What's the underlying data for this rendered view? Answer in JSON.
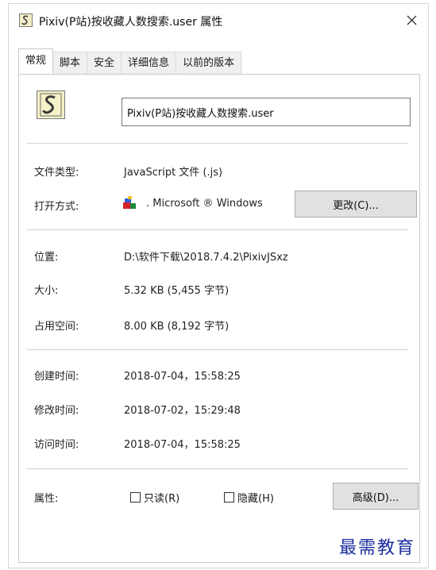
{
  "window": {
    "title": "Pixiv(P站)按收藏人数搜索.user 属性",
    "close_symbol": "✕"
  },
  "tabs": [
    {
      "label": "常规",
      "active": true
    },
    {
      "label": "脚本",
      "active": false
    },
    {
      "label": "安全",
      "active": false
    },
    {
      "label": "详细信息",
      "active": false
    },
    {
      "label": "以前的版本",
      "active": false
    }
  ],
  "file": {
    "icon": "script-file-icon",
    "name": "Pixiv(P站)按收藏人数搜索.user"
  },
  "type": {
    "label": "文件类型:",
    "value": "JavaScript 文件 (.js)"
  },
  "open_with": {
    "label": "打开方式:",
    "app_icon": "windows-script-host-icon",
    "value": ". Microsoft ® Windows",
    "change_button": "更改(C)..."
  },
  "location": {
    "label": "位置:",
    "value": "D:\\软件下载\\2018.7.4.2\\PixivJSxz"
  },
  "size": {
    "label": "大小:",
    "value": "5.32 KB (5,455 字节)"
  },
  "size_on_disk": {
    "label": "占用空间:",
    "value": "8.00 KB (8,192 字节)"
  },
  "created": {
    "label": "创建时间:",
    "value": "2018-07-04，15:58:25"
  },
  "modified": {
    "label": "修改时间:",
    "value": "2018-07-02，15:29:48"
  },
  "accessed": {
    "label": "访问时间:",
    "value": "2018-07-04，15:58:25"
  },
  "attributes": {
    "label": "属性:",
    "readonly": {
      "label": "只读(R)",
      "checked": false
    },
    "hidden": {
      "label": "隐藏(H)",
      "checked": false
    },
    "advanced_button": "高级(D)..."
  },
  "watermark": "最需教育",
  "colors": {
    "border": "#d6d6d6",
    "button_bg": "#e1e1e1",
    "watermark": "#1f2f9f"
  }
}
